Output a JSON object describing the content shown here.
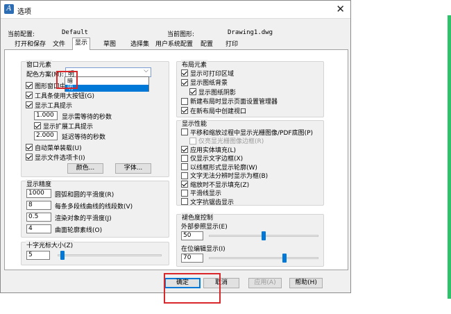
{
  "window": {
    "title": "选项",
    "close_glyph": "✕"
  },
  "header": {
    "current_profile_label": "当前配置:",
    "current_profile_value": "Default",
    "current_drawing_label": "当前图形:",
    "current_drawing_value": "Drawing1.dwg"
  },
  "tabs": [
    "打开和保存",
    "文件",
    "显示",
    "草图",
    "选择集",
    "用户系统配置",
    "配置",
    "打印"
  ],
  "window_elements": {
    "title": "窗口元素",
    "color_scheme_label": "配色方案(M):",
    "color_scheme_value": "明",
    "color_scheme_options": [
      "暗",
      "明"
    ],
    "checkboxes": [
      {
        "label": "图形窗口中",
        "checked": true
      },
      {
        "label": "工具条使用大按钮(G)",
        "checked": true
      },
      {
        "label": "显示工具提示",
        "checked": true
      }
    ],
    "tooltip_delay_value": "1.000",
    "tooltip_delay_label": "显示需等待的秒数",
    "ext_tooltip_label": "显示扩展工具提示",
    "ext_tooltip_checked": true,
    "ext_delay_value": "2.000",
    "ext_delay_label": "延迟等待的秒数",
    "auto_menu_label": "自动菜单装载(U)",
    "auto_menu_checked": true,
    "file_tabs_label": "显示文件选项卡(I)",
    "file_tabs_checked": true,
    "colors_button": "颜色...",
    "fonts_button": "字体..."
  },
  "display_precision": {
    "title": "显示精度",
    "rows": [
      {
        "value": "1000",
        "label": "圆弧和圆的平滑度(R)"
      },
      {
        "value": "8",
        "label": "每条多段线曲线的线段数(V)"
      },
      {
        "value": "0.5",
        "label": "渲染对象的平滑度(J)"
      },
      {
        "value": "4",
        "label": "曲面轮廓素线(O)"
      }
    ]
  },
  "crosshair": {
    "title": "十字光标大小(Z)",
    "value": "5",
    "level_percent": 3
  },
  "layout_elements": {
    "title": "布局元素",
    "items": [
      {
        "label": "显示可打印区域",
        "checked": true,
        "indent": false
      },
      {
        "label": "显示图纸背景",
        "checked": true,
        "indent": false
      },
      {
        "label": "显示图纸阴影",
        "checked": true,
        "indent": true
      },
      {
        "label": "新建布局时显示页面设置管理器",
        "checked": false,
        "indent": false
      },
      {
        "label": "在新布局中创建视口",
        "checked": true,
        "indent": false
      }
    ]
  },
  "display_performance": {
    "title": "显示性能",
    "items": [
      {
        "label": "平移和缩放过程中显示光栅图像/PDF底图(P)",
        "checked": false,
        "disabled": false,
        "indent": false
      },
      {
        "label": "仅亮显光栅图像边框(R)",
        "checked": false,
        "disabled": true,
        "indent": true
      },
      {
        "label": "应用实体填充(L)",
        "checked": true,
        "disabled": false,
        "indent": false
      },
      {
        "label": "仅显示文字边框(X)",
        "checked": false,
        "disabled": false,
        "indent": false
      },
      {
        "label": "以线框形式显示轮廓(W)",
        "checked": false,
        "disabled": false,
        "indent": false
      },
      {
        "label": "文字无法分辨时显示为框(B)",
        "checked": false,
        "disabled": false,
        "indent": false
      },
      {
        "label": "缩放时不显示填充(Z)",
        "checked": true,
        "disabled": false,
        "indent": false
      },
      {
        "label": "平滑线显示",
        "checked": false,
        "disabled": false,
        "indent": false
      },
      {
        "label": "文字抗锯齿显示",
        "checked": false,
        "disabled": false,
        "indent": false
      }
    ]
  },
  "fade_control": {
    "title": "褪色度控制",
    "xref_label": "外部参照显示(E)",
    "xref_value": "50",
    "xref_level_percent": 50,
    "inplace_label": "在位编辑显示(I)",
    "inplace_value": "70",
    "inplace_level_percent": 70
  },
  "buttons": {
    "ok": "确定",
    "cancel": "取消",
    "apply": "应用(A)",
    "help": "帮助(H)"
  },
  "colors": {
    "highlight": "#d9262b",
    "selection": "#0078d7",
    "accent_bar": "#2cc36b"
  }
}
